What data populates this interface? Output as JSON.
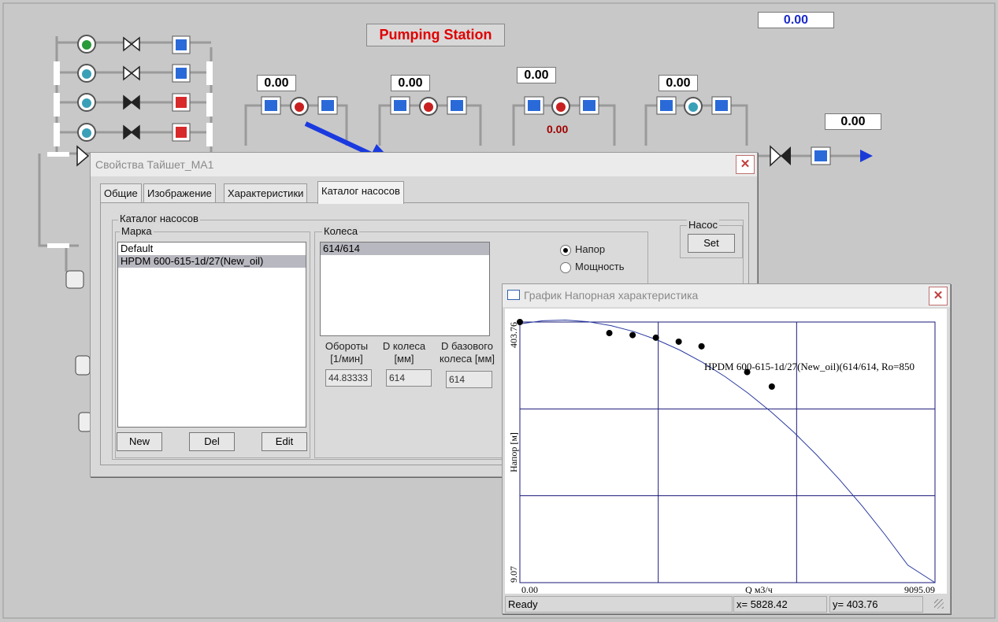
{
  "station": {
    "title": "Pumping Station",
    "top_value": "0.00",
    "values": [
      "0.00",
      "0.00",
      "0.00",
      "0.00"
    ],
    "red_value": "0.00",
    "right_value": "0.00"
  },
  "dialog": {
    "title": "Свойства Тайшет_МА1",
    "tabs": [
      "Общие",
      "Изображение",
      "Характеристики",
      "Каталог насосов"
    ],
    "group_catalog": "Каталог насосов",
    "group_brand": "Марка",
    "brand_items": [
      "Default",
      "HPDM 600-615-1d/27(New_oil)"
    ],
    "group_wheels": "Колеса",
    "wheel_items": [
      "614/614"
    ],
    "radio_head": "Напор",
    "radio_power": "Мощность",
    "group_pump": "Насос",
    "set_button": "Set",
    "buttons": {
      "new": "New",
      "del": "Del",
      "edit": "Edit"
    },
    "rpm_label_1": "Обороты",
    "rpm_label_2": "[1/мин]",
    "rpm_value": "44.83333",
    "dwheel_label_1": "D колеса",
    "dwheel_label_2": "[мм]",
    "dwheel_value": "614",
    "dbase_label_1": "D базового",
    "dbase_label_2": "колеса [мм]",
    "dbase_value": "614"
  },
  "graph_window": {
    "title": "График Напорная характеристика",
    "status_ready": "Ready",
    "status_x": "x= 5828.42",
    "status_y": "y= 403.76"
  },
  "chart_data": {
    "type": "line",
    "xlabel": "Q м3/ч",
    "ylabel": "Напор [м]",
    "xlim": [
      0.0,
      9095.09
    ],
    "ylim": [
      9.07,
      403.76
    ],
    "x_min_label": "0.00",
    "x_max_label": "9095.09",
    "y_min_label": "9.07",
    "y_max_label": "403.76",
    "grid": true,
    "series": [
      {
        "name": "HPDM 600-615-1d/27(New_oil)(614/614, Ro=850",
        "x": [
          0,
          500,
          1000,
          1500,
          2000,
          2500,
          3000,
          3500,
          4000,
          4500,
          5000,
          5500,
          6000,
          6500,
          7000,
          7500,
          8000,
          8500,
          9095.09
        ],
        "y": [
          400.9,
          405.7,
          406.7,
          404.2,
          398.3,
          389.2,
          376.9,
          361.4,
          342.7,
          320.9,
          296.0,
          268.0,
          236.9,
          202.7,
          165.4,
          125.1,
          81.8,
          35.5,
          9.07
        ]
      }
    ],
    "points": {
      "x": [
        0,
        1960,
        2470,
        2980,
        3480,
        3980,
        4980,
        5520
      ],
      "y": [
        403.76,
        387,
        384,
        380,
        374,
        367,
        328,
        306
      ]
    }
  }
}
